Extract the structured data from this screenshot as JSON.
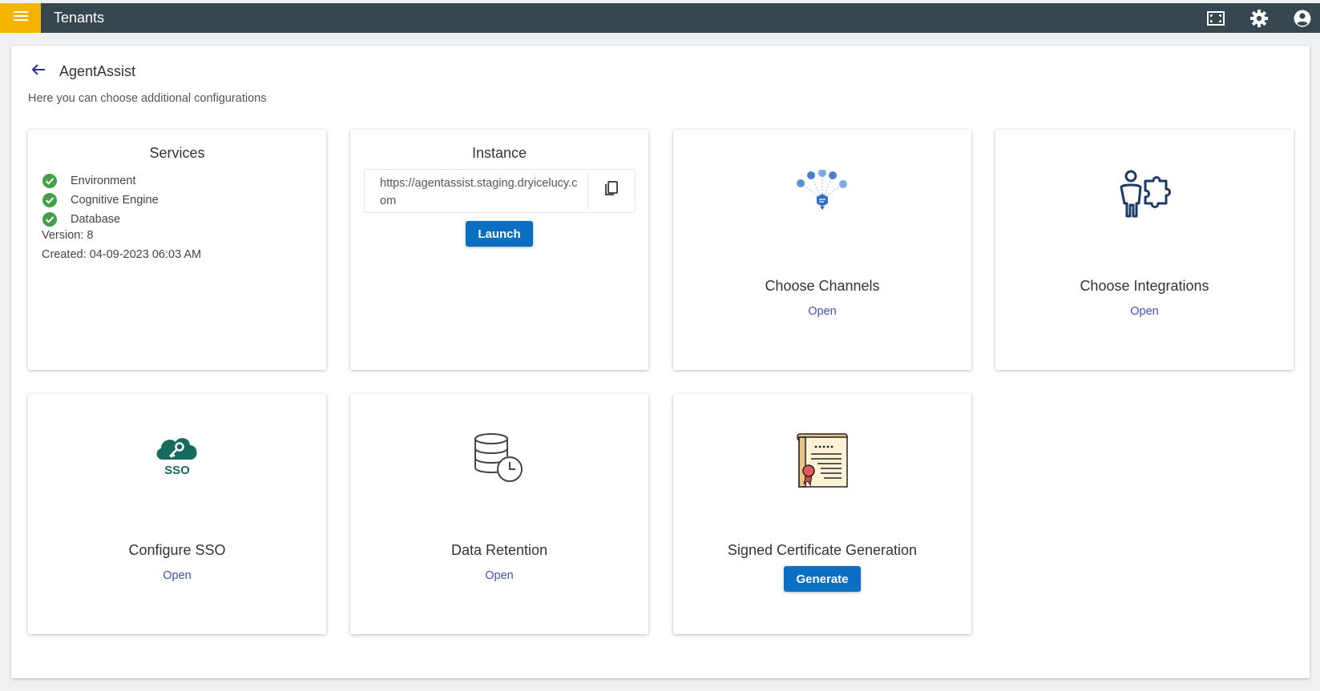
{
  "topbar": {
    "title": "Tenants",
    "menu_icon": "hamburger-icon",
    "actions": [
      "fullscreen-icon",
      "gear-icon",
      "account-icon"
    ],
    "accent": "#f5b400",
    "bar_color": "#37474f"
  },
  "page": {
    "title": "AgentAssist",
    "subtitle": "Here you can choose additional configurations"
  },
  "services": {
    "title": "Services",
    "items": [
      {
        "label": "Environment"
      },
      {
        "label": "Cognitive Engine"
      },
      {
        "label": "Database"
      }
    ],
    "version": "Version: 8",
    "created": "Created: 04-09-2023 06:03 AM",
    "status_color": "#43a047"
  },
  "instance": {
    "title": "Instance",
    "url": "https://agentassist.staging.dryicelucy.com",
    "launch_label": "Launch"
  },
  "channels": {
    "title": "Choose Channels",
    "link": "Open",
    "icon": "channels-icon"
  },
  "integrations": {
    "title": "Choose Integrations",
    "link": "Open",
    "icon": "integrations-icon"
  },
  "sso": {
    "title": "Configure SSO",
    "link": "Open",
    "icon": "sso-cloud-icon",
    "icon_text": "SSO"
  },
  "retention": {
    "title": "Data Retention",
    "link": "Open",
    "icon": "database-clock-icon"
  },
  "certificate": {
    "title": "Signed Certificate Generation",
    "button_label": "Generate",
    "icon": "certificate-icon"
  },
  "colors": {
    "primary_button": "#0a6fc2",
    "link": "#3f51b5"
  }
}
